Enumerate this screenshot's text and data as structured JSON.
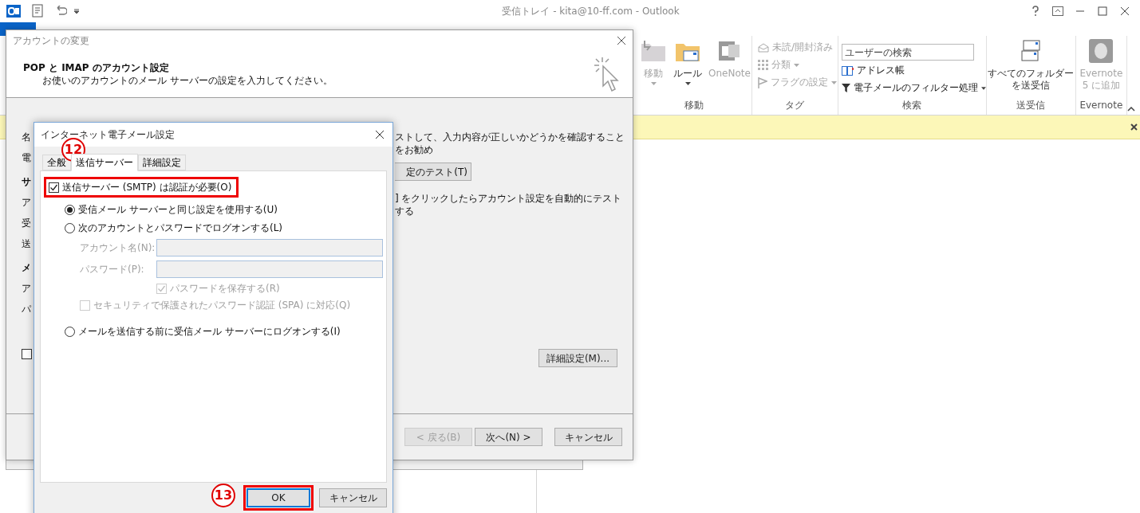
{
  "app_window": {
    "title": "受信トレイ - kita@10-ff.com - Outlook"
  },
  "ribbon": {
    "groups": [
      {
        "label": "移動",
        "buttons": [
          {
            "label": "移動",
            "disabled": true
          },
          {
            "label": "ルール",
            "disabled": false
          },
          {
            "label": "OneNote",
            "disabled": true
          }
        ]
      },
      {
        "label": "タグ",
        "buttons": [
          {
            "label": "未読/開封済み",
            "disabled": true
          },
          {
            "label": "分類",
            "disabled": true
          },
          {
            "label": "フラグの設定",
            "disabled": true
          }
        ]
      },
      {
        "label": "検索",
        "search": {
          "placeholder": "ユーザーの検索"
        },
        "buttons": [
          {
            "label": "アドレス帳",
            "disabled": false
          },
          {
            "label": "電子メールのフィルター処理",
            "disabled": false
          }
        ]
      },
      {
        "label": "送受信",
        "buttons": [
          {
            "lines": [
              "すべてのフォルダー",
              "を送受信"
            ],
            "disabled": false
          }
        ]
      },
      {
        "label": "Evernote",
        "buttons": [
          {
            "lines": [
              "Evernote",
              "5 に追加"
            ],
            "disabled": true
          }
        ]
      }
    ]
  },
  "account_dialog": {
    "title": "アカウントの変更",
    "heading": "POP と IMAP のアカウント設定",
    "subheading": "お使いのアカウントのメール サーバーの設定を入力してください。",
    "left_labels": [
      "名",
      "電",
      "サ",
      "ア",
      "受",
      "送",
      "メ",
      "ア",
      "パ"
    ],
    "left_checkbox": {
      "checked": false
    },
    "test_text": "ストして、入力内容が正しいかどうかを確認することをお勧め",
    "test_button": "定のテスト(T)",
    "auto_test_text": "] をクリックしたらアカウント設定を自動的にテストする",
    "more_settings_button": "詳細設定(M)...",
    "footer_buttons": [
      {
        "label": "< 戻る(B)",
        "disabled": true
      },
      {
        "label": "次へ(N) >",
        "disabled": false
      },
      {
        "label": "キャンセル",
        "disabled": false
      }
    ]
  },
  "email_settings_dialog": {
    "title": "インターネット電子メール設定",
    "tabs": [
      {
        "label": "全般",
        "selected": false
      },
      {
        "label": "送信サーバー",
        "selected": true
      },
      {
        "label": "詳細設定",
        "selected": false
      }
    ],
    "smtp_auth": {
      "label": "送信サーバー (SMTP) は認証が必要(O)",
      "checked": true
    },
    "auth_options": [
      {
        "label": "受信メール サーバーと同じ設定を使用する(U)",
        "selected": true
      },
      {
        "label": "次のアカウントとパスワードでログオンする(L)",
        "selected": false
      },
      {
        "label": "メールを送信する前に受信メール サーバーにログオンする(I)",
        "selected": false
      }
    ],
    "fields": [
      {
        "label": "アカウント名(N):",
        "disabled": true
      },
      {
        "label": "パスワード(P):",
        "disabled": true
      }
    ],
    "remember_password": {
      "label": "パスワードを保存する(R)",
      "checked": true,
      "disabled": true
    },
    "spa": {
      "label": "セキュリティで保護されたパスワード認証 (SPA) に対応(Q)",
      "checked": false,
      "disabled": true
    },
    "buttons": [
      {
        "label": "OK",
        "focused": true
      },
      {
        "label": "キャンセル",
        "focused": false
      }
    ]
  },
  "annotations": [
    {
      "label": "12"
    },
    {
      "label": "13"
    }
  ]
}
